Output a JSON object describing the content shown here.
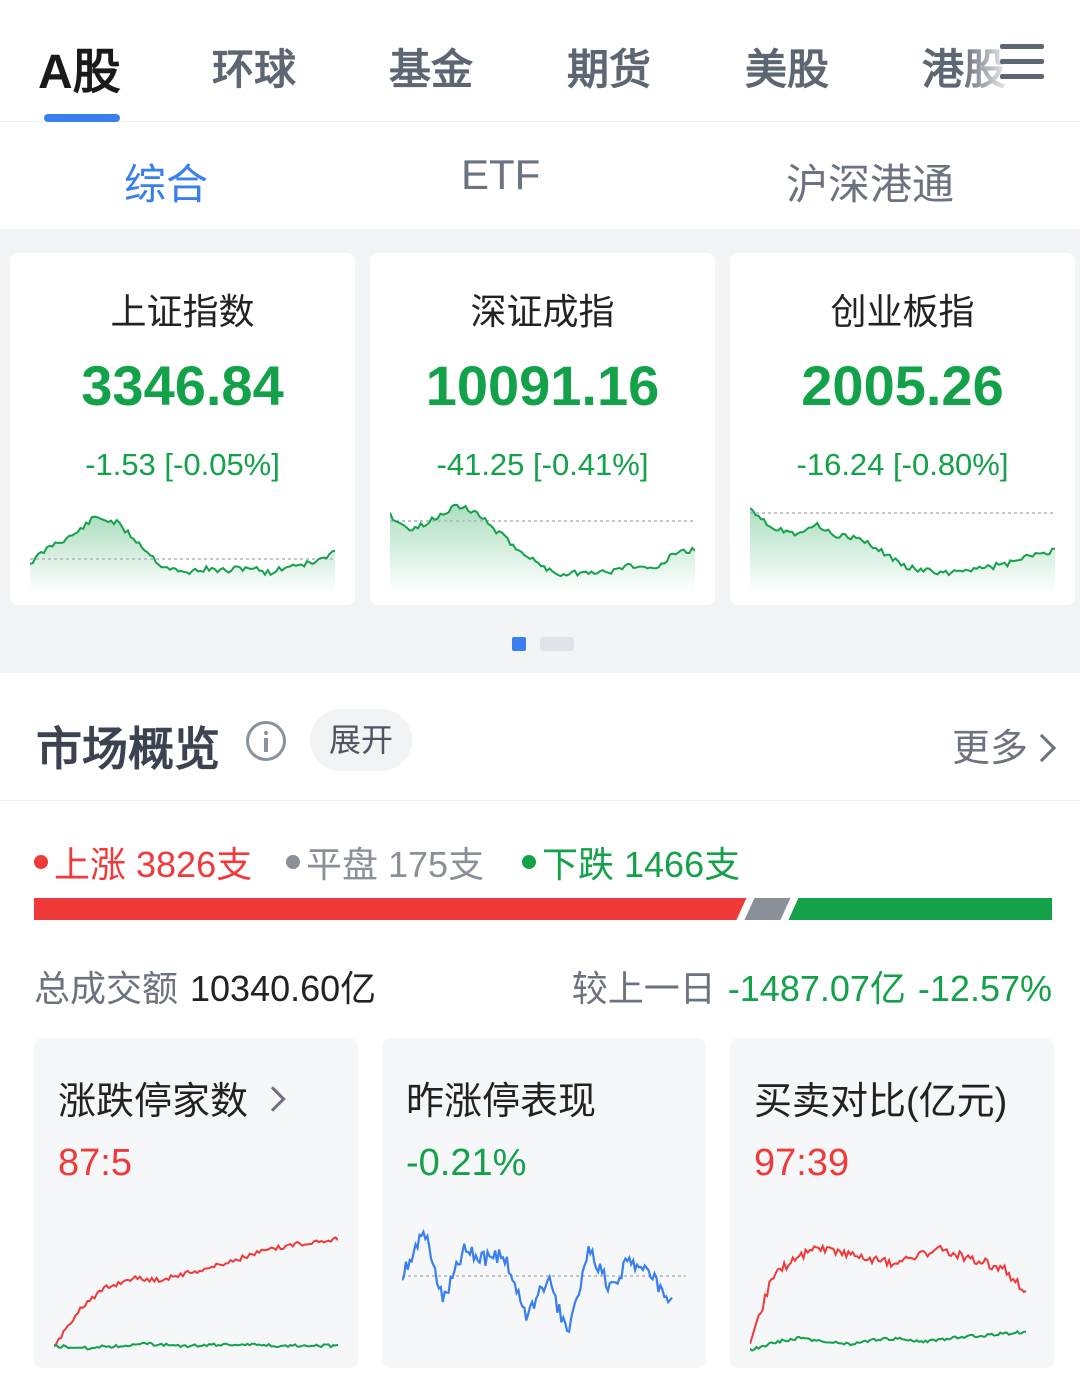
{
  "top_tabs": {
    "items": [
      {
        "label": "A股"
      },
      {
        "label": "环球"
      },
      {
        "label": "基金"
      },
      {
        "label": "期货"
      },
      {
        "label": "美股"
      },
      {
        "label": "港股"
      }
    ],
    "active_index": 0,
    "menu_icon": "hamburger-menu-icon"
  },
  "sub_tabs": {
    "items": [
      {
        "label": "综合"
      },
      {
        "label": "ETF"
      },
      {
        "label": "沪深港通"
      }
    ],
    "active_index": 0
  },
  "indices": [
    {
      "name": "上证指数",
      "value": "3346.84",
      "change": "-1.53 [-0.05%]"
    },
    {
      "name": "深证成指",
      "value": "10091.16",
      "change": "-41.25 [-0.41%]"
    },
    {
      "name": "创业板指",
      "value": "2005.26",
      "change": "-16.24 [-0.80%]"
    }
  ],
  "pager": {
    "pages": 2,
    "active": 0
  },
  "overview": {
    "title": "市场概览",
    "info_icon": "info-icon",
    "expand_label": "展开",
    "more_label": "更多"
  },
  "breadth": {
    "up_label": "上涨 3826支",
    "flat_label": "平盘 175支",
    "down_label": "下跌 1466支",
    "up_count": 3826,
    "flat_count": 175,
    "down_count": 1466
  },
  "turnover": {
    "label": "总成交额",
    "value": "10340.60亿",
    "compare_label": "较上一日",
    "compare_value": "-1487.07亿",
    "compare_pct": "-12.57%"
  },
  "stat_cards": [
    {
      "title": "涨跌停家数",
      "value": "87:5"
    },
    {
      "title": "昨涨停表现",
      "value": "-0.21%"
    },
    {
      "title": "买卖对比(亿元)",
      "value": "97:39"
    }
  ],
  "colors": {
    "accent": "#3a7ff0",
    "up": "#f03a3a",
    "down": "#13a14a",
    "flat": "#8a8f98"
  }
}
